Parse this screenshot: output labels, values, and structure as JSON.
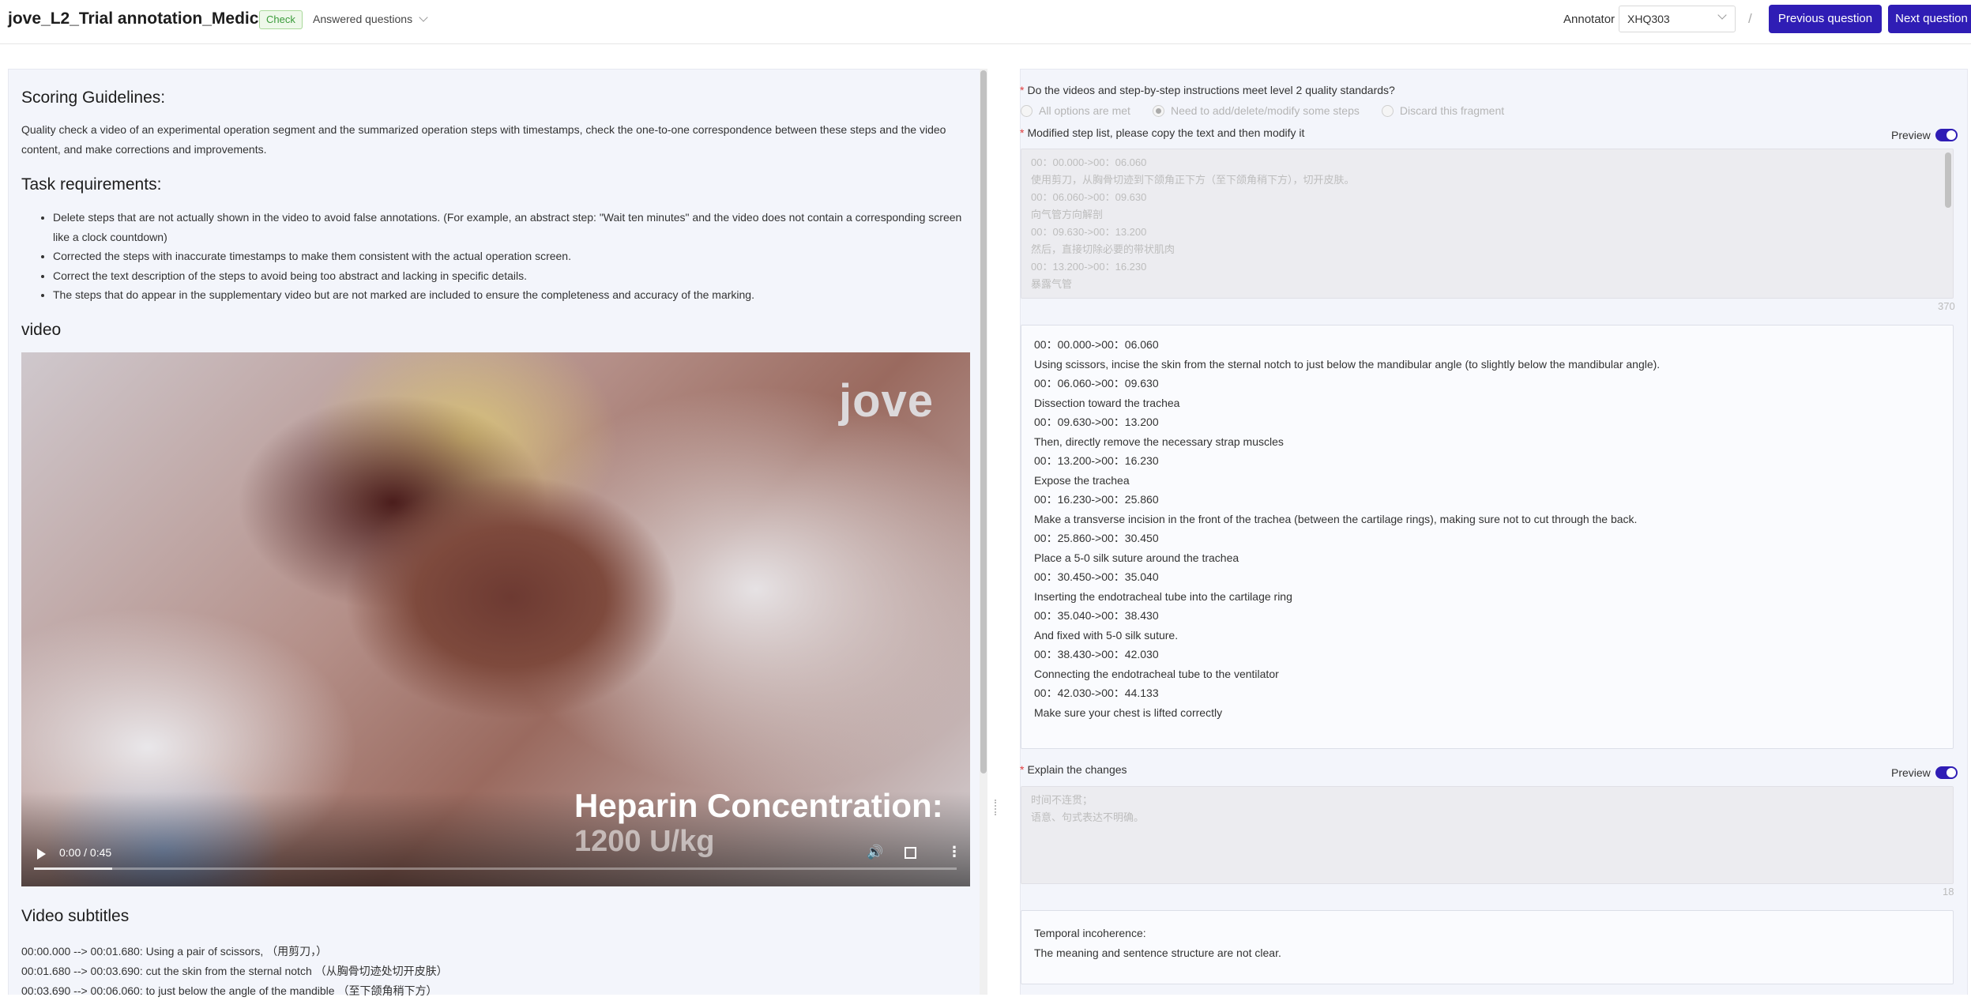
{
  "header": {
    "title": "jove_L2_Trial annotation_Medical",
    "badge": "Check",
    "answered_questions": "Answered questions",
    "annotator_label": "Annotator",
    "annotator_value": "XHQ303",
    "separator": "/",
    "prev_button": "Previous question",
    "next_button": "Next question"
  },
  "guidelines": {
    "scoring_heading": "Scoring Guidelines:",
    "scoring_text": "Quality check a video of an experimental operation segment and the summarized operation steps with timestamps, check the one-to-one correspondence between these steps and the video content, and make corrections and improvements.",
    "task_heading": "Task requirements:",
    "requirements": [
      "Delete steps that are not actually shown in the video to avoid false annotations. (For example, an abstract step: \"Wait ten minutes\" and the video does not contain a corresponding screen like a clock countdown)",
      "Corrected the steps with inaccurate timestamps to make them consistent with the actual operation screen.",
      "Correct the text description of the steps to avoid being too abstract and lacking in specific details.",
      "The steps that do appear in the supplementary video but are not marked are included to ensure the completeness and accuracy of the marking."
    ],
    "video_heading": "video"
  },
  "video": {
    "watermark": "jove",
    "overlay_line1": "Heparin Concentration:",
    "overlay_line2": "1200 U/kg",
    "time": "0:00 / 0:45",
    "progress": 0.085
  },
  "subtitles": {
    "heading": "Video subtitles",
    "lines": [
      "00:00.000 --> 00:01.680: Using a pair of scissors, （用剪刀，）",
      "00:01.680 --> 00:03.690: cut the skin from the sternal notch （从胸骨切迹处切开皮肤）",
      "00:03.690 --> 00:06.060: to just below the angle of the mandible （至下颌角稍下方）"
    ]
  },
  "form": {
    "q1_label": "Do the videos and step-by-step instructions meet level 2 quality standards?",
    "q1_options": [
      "All options are met",
      "Need to add/delete/modify some steps",
      "Discard this fragment"
    ],
    "q1_selected": 1,
    "q2_label": "Modified step list, please copy the text and then modify it",
    "preview_label": "Preview",
    "q2_textarea_lines": [
      "00：00.000->00：06.060",
      "使用剪刀，从胸骨切迹到下颌角正下方（至下颌角稍下方），切开皮肤。",
      "00：06.060->00：09.630",
      "向气管方向解剖",
      "00：09.630->00：13.200",
      "然后，直接切除必要的带状肌肉",
      "00：13.200->00：16.230",
      "暴露气管"
    ],
    "q2_count": "370",
    "q2_preview_lines": [
      "00：00.000->00：06.060",
      "Using scissors, incise the skin from the sternal notch to just below the mandibular angle (to slightly below the mandibular angle).",
      "00：06.060->00：09.630",
      "Dissection toward the trachea",
      "00：09.630->00：13.200",
      "Then, directly remove the necessary strap muscles",
      "00：13.200->00：16.230",
      "Expose the trachea",
      "00：16.230->00：25.860",
      "Make a transverse incision in the front of the trachea (between the cartilage rings), making sure not to cut through the back.",
      "00：25.860->00：30.450",
      "Place a 5-0 silk suture around the trachea",
      "00：30.450->00：35.040",
      "Inserting the endotracheal tube into the cartilage ring",
      "00：35.040->00：38.430",
      "And fixed with 5-0 silk suture.",
      "00：38.430->00：42.030",
      "Connecting the endotracheal tube to the ventilator",
      "00：42.030->00：44.133",
      "Make sure your chest is lifted correctly"
    ],
    "q3_label": "Explain the changes",
    "q3_textarea_lines": [
      "时间不连贯；",
      "语意、句式表达不明确。"
    ],
    "q3_count": "18",
    "q3_preview_lines": [
      "Temporal incoherence:",
      "The meaning and sentence structure are not clear."
    ]
  }
}
